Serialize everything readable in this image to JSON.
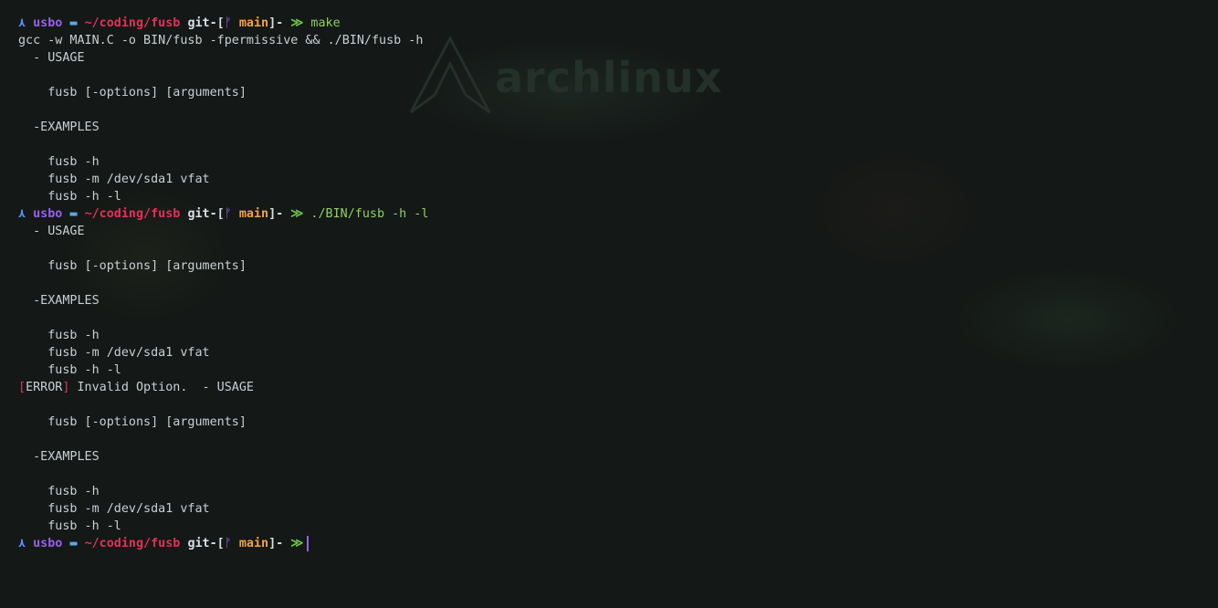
{
  "prompt": {
    "arch_icon": "arch-logo-icon",
    "user": "usbo",
    "folder_icon": "folder-icon",
    "path": "~/coding/fusb",
    "git_open": "git-[",
    "branch_icon": "git-branch-icon",
    "branch_glyph": "ᚠ",
    "branch": "main",
    "git_close": "]-",
    "symbol": "≫"
  },
  "colors": {
    "arch": "#5b8ef0",
    "user": "#9a5ff0",
    "path": "#e5305a",
    "branch": "#f0a24a",
    "prompt_symbol": "#6ec247",
    "command": "#8fd062",
    "error": "#e5305a",
    "text": "#c9cfd4"
  },
  "commands": {
    "c1": "make",
    "c2": "./BIN/fusb -h -l"
  },
  "output": {
    "gcc_line": "gcc -w MAIN.C -o BIN/fusb -fpermissive && ./BIN/fusb -h",
    "usage1": "  - USAGE",
    "syntax1": "    fusb [-options] [arguments]",
    "examples1": "  -EXAMPLES",
    "ex1a": "    fusb -h",
    "ex1b": "    fusb -m /dev/sda1 vfat",
    "ex1c": "    fusb -h -l",
    "usage2": "  - USAGE",
    "syntax2": "    fusb [-options] [arguments]",
    "examples2": "  -EXAMPLES",
    "ex2a": "    fusb -h",
    "ex2b": "    fusb -m /dev/sda1 vfat",
    "ex2c": "    fusb -h -l",
    "err_open": "[",
    "err_word": "ERROR",
    "err_close": "]",
    "err_msg": " Invalid Option.  - USAGE",
    "syntax3": "    fusb [-options] [arguments]",
    "examples3": "  -EXAMPLES",
    "ex3a": "    fusb -h",
    "ex3b": "    fusb -m /dev/sda1 vfat",
    "ex3c": "    fusb -h -l"
  },
  "wallpaper": {
    "watermark": "archlinux"
  }
}
